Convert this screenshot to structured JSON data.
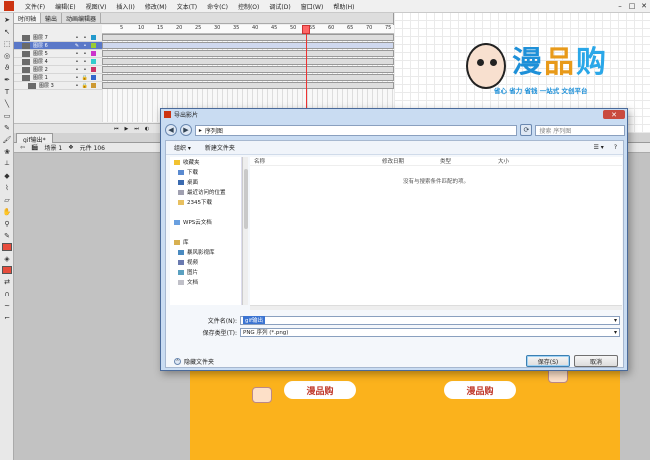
{
  "menubar": {
    "items": [
      "文件(F)",
      "编辑(E)",
      "视图(V)",
      "插入(I)",
      "修改(M)",
      "文本(T)",
      "命令(C)",
      "控制(O)",
      "调试(D)",
      "窗口(W)",
      "帮助(H)"
    ],
    "minimize": "–",
    "maximize": "□",
    "close": "✕"
  },
  "timeline": {
    "tabs": [
      "时间轴",
      "输出",
      "动画编辑器"
    ],
    "ruler_ticks": [
      "5",
      "10",
      "15",
      "20",
      "25",
      "30",
      "35",
      "40",
      "45",
      "50",
      "55",
      "60",
      "65",
      "70",
      "75"
    ],
    "layers": [
      {
        "name": "图层 7",
        "selected": false
      },
      {
        "name": "图层 6",
        "selected": true
      },
      {
        "name": "图层 5",
        "selected": false
      },
      {
        "name": "图层 4",
        "selected": false
      },
      {
        "name": "图层 2",
        "selected": false
      },
      {
        "name": "图层 1",
        "selected": false
      },
      {
        "name": "图层 3",
        "selected": false
      }
    ]
  },
  "logo": {
    "char1": "漫",
    "char2": "品",
    "char3": "购",
    "slogan": "省心  省力  省钱 一站式 文创平台"
  },
  "document": {
    "tab": "gif输出*",
    "scene": "场景 1",
    "symbol": "元件 106"
  },
  "artwork": {
    "button1": "漫品购",
    "button2": "漫品购"
  },
  "dialog": {
    "title": "导出影片",
    "close": "✕",
    "back": "◀",
    "forward": "▶",
    "path": "序列图",
    "search_placeholder": "搜索 序列图",
    "organize": "组织 ▾",
    "new_folder": "新建文件夹",
    "view_icon": "☰ ▾",
    "help_icon": "?",
    "nav": [
      {
        "label": "收藏夹",
        "group": true
      },
      {
        "label": "下载",
        "group": false
      },
      {
        "label": "桌面",
        "group": false
      },
      {
        "label": "最近访问的位置",
        "group": false
      },
      {
        "label": "2345下载",
        "group": false
      },
      {
        "label": "",
        "group": false
      },
      {
        "label": "WPS云文档",
        "group": true
      },
      {
        "label": "",
        "group": false
      },
      {
        "label": "库",
        "group": true
      },
      {
        "label": "暴风影视库",
        "group": false
      },
      {
        "label": "视频",
        "group": false
      },
      {
        "label": "图片",
        "group": false
      },
      {
        "label": "文档",
        "group": false
      }
    ],
    "columns": [
      "名称",
      "修改日期",
      "类型",
      "大小"
    ],
    "empty_message": "没有与搜索条件匹配的项。",
    "filename_label": "文件名(N):",
    "filename_value": "gif输出",
    "filetype_label": "保存类型(T):",
    "filetype_value": "PNG 序列 (*.png)",
    "hide_folders": "隐藏文件夹",
    "save_button": "保存(S)",
    "cancel_button": "取消"
  }
}
